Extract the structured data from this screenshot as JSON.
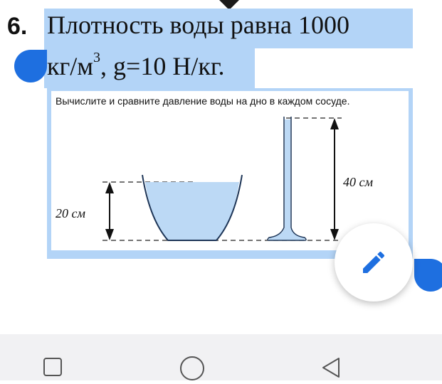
{
  "question": {
    "number": "6.",
    "line1": "Плотность воды  равна 1000",
    "line2_pre": "кг/м",
    "line2_sup": "3",
    "line2_post": ", g=10 Н/кг."
  },
  "figure": {
    "caption": "Вычислите и сравните давление воды на дно в каждом сосуде.",
    "left_height": "20 см",
    "right_height": "40 см",
    "water_color": "#bcd9f5"
  },
  "fab": {
    "icon": "pencil-icon",
    "color": "#1e6fe0"
  },
  "selection": {
    "color": "#b3d4f7",
    "handle_color": "#1e6fe0"
  },
  "navbar": {
    "icons": [
      "square-icon",
      "circle-icon",
      "back-triangle-icon"
    ]
  }
}
